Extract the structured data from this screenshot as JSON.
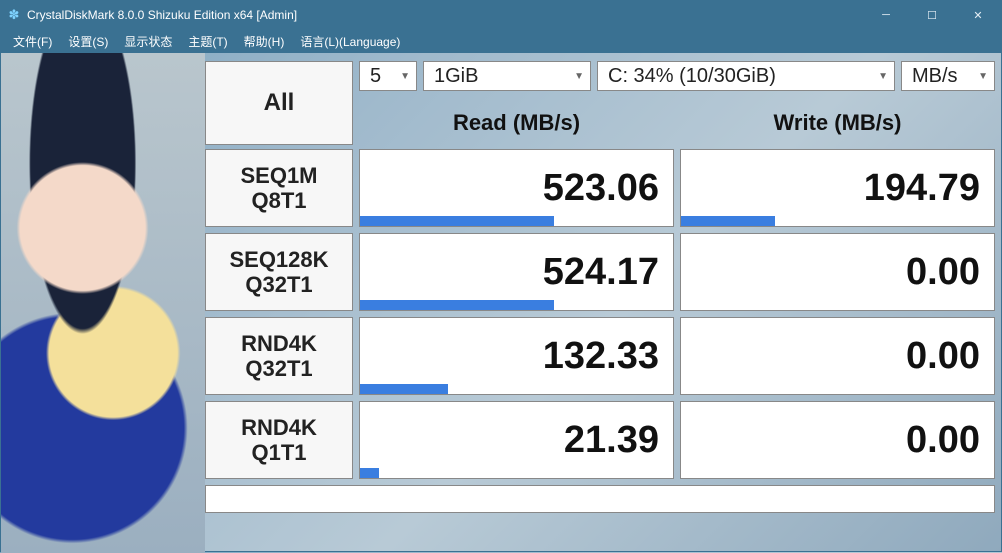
{
  "window": {
    "title": "CrystalDiskMark 8.0.0 Shizuku Edition x64 [Admin]"
  },
  "menu": {
    "file": "文件(F)",
    "settings": "设置(S)",
    "display": "显示状态",
    "theme": "主题(T)",
    "help": "帮助(H)",
    "language": "语言(L)(Language)"
  },
  "controls": {
    "all": "All",
    "count": "5",
    "size": "1GiB",
    "drive": "C: 34% (10/30GiB)",
    "unit": "MB/s"
  },
  "headers": {
    "read": "Read (MB/s)",
    "write": "Write (MB/s)"
  },
  "rows": [
    {
      "label1": "SEQ1M",
      "label2": "Q8T1",
      "read": "523.06",
      "readPct": 62,
      "write": "194.79",
      "writePct": 30
    },
    {
      "label1": "SEQ128K",
      "label2": "Q32T1",
      "read": "524.17",
      "readPct": 62,
      "write": "0.00",
      "writePct": 0
    },
    {
      "label1": "RND4K",
      "label2": "Q32T1",
      "read": "132.33",
      "readPct": 28,
      "write": "0.00",
      "writePct": 0
    },
    {
      "label1": "RND4K",
      "label2": "Q1T1",
      "read": "21.39",
      "readPct": 6,
      "write": "0.00",
      "writePct": 0
    }
  ]
}
